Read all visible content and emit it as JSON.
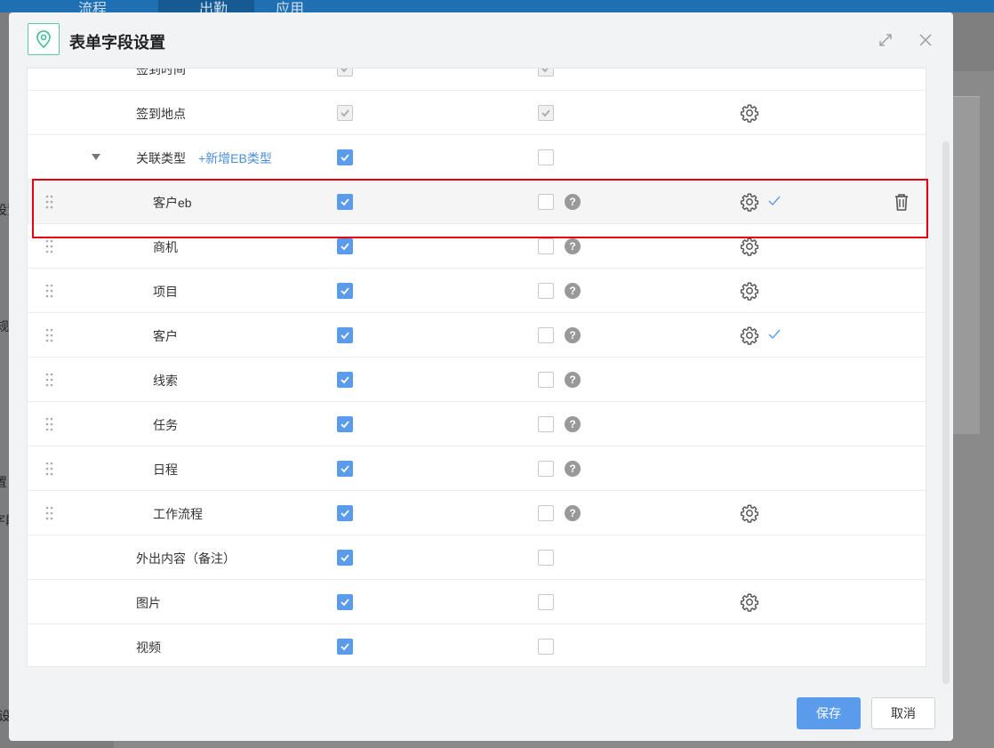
{
  "background": {
    "nav_items": [
      "流程",
      "出勤",
      "应用"
    ],
    "edge_texts": [
      "设置",
      "规",
      "置",
      "字段",
      "设"
    ]
  },
  "modal": {
    "title": "表单字段设置",
    "icon": "location-pin-icon",
    "accent_color": "#5b9bec",
    "highlight_color": "#e60012"
  },
  "rows": [
    {
      "label": "签到时间",
      "level": 0,
      "col1": "disabled-checked",
      "col2": "disabled-checked",
      "help": false,
      "gear": false,
      "tick": false,
      "drag": false,
      "trash": false
    },
    {
      "label": "签到地点",
      "level": 0,
      "col1": "disabled-checked",
      "col2": "disabled-checked",
      "help": false,
      "gear": true,
      "tick": false,
      "drag": false,
      "trash": false
    },
    {
      "label": "关联类型",
      "level": 0,
      "col1": "checked",
      "col2": "unchecked",
      "help": false,
      "gear": false,
      "tick": false,
      "drag": false,
      "trash": false,
      "caret": true,
      "add_link": "+新增EB类型"
    },
    {
      "label": "客户eb",
      "level": 1,
      "col1": "checked",
      "col2": "unchecked",
      "help": true,
      "gear": true,
      "tick": true,
      "drag": true,
      "trash": true,
      "highlight": true
    },
    {
      "label": "商机",
      "level": 1,
      "col1": "checked",
      "col2": "unchecked",
      "help": true,
      "gear": true,
      "tick": false,
      "drag": true,
      "trash": false
    },
    {
      "label": "项目",
      "level": 1,
      "col1": "checked",
      "col2": "unchecked",
      "help": true,
      "gear": true,
      "tick": false,
      "drag": true,
      "trash": false
    },
    {
      "label": "客户",
      "level": 1,
      "col1": "checked",
      "col2": "unchecked",
      "help": true,
      "gear": true,
      "tick": true,
      "drag": true,
      "trash": false
    },
    {
      "label": "线索",
      "level": 1,
      "col1": "checked",
      "col2": "unchecked",
      "help": true,
      "gear": false,
      "tick": false,
      "drag": true,
      "trash": false
    },
    {
      "label": "任务",
      "level": 1,
      "col1": "checked",
      "col2": "unchecked",
      "help": true,
      "gear": false,
      "tick": false,
      "drag": true,
      "trash": false
    },
    {
      "label": "日程",
      "level": 1,
      "col1": "checked",
      "col2": "unchecked",
      "help": true,
      "gear": false,
      "tick": false,
      "drag": true,
      "trash": false
    },
    {
      "label": "工作流程",
      "level": 1,
      "col1": "checked",
      "col2": "unchecked",
      "help": true,
      "gear": true,
      "tick": false,
      "drag": true,
      "trash": false
    },
    {
      "label": "外出内容（备注）",
      "level": 0,
      "col1": "checked",
      "col2": "unchecked",
      "help": false,
      "gear": false,
      "tick": false,
      "drag": false,
      "trash": false
    },
    {
      "label": "图片",
      "level": 0,
      "col1": "checked",
      "col2": "unchecked",
      "help": false,
      "gear": true,
      "tick": false,
      "drag": false,
      "trash": false
    },
    {
      "label": "视频",
      "level": 0,
      "col1": "checked",
      "col2": "unchecked",
      "help": false,
      "gear": false,
      "tick": false,
      "drag": false,
      "trash": false
    }
  ],
  "help_glyph": "?",
  "footer": {
    "save_label": "保存",
    "cancel_label": "取消"
  }
}
